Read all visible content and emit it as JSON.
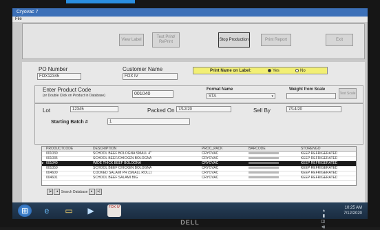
{
  "window": {
    "title": "Cryovac 7",
    "menu": "File"
  },
  "toolbar": {
    "view_label": "View Label",
    "test_print": "Test Print/ RePrint",
    "stop_production": "Stop Production",
    "print_report": "Print Report",
    "exit": "Exit"
  },
  "po": {
    "label": "PO Number",
    "value": "FOX12345"
  },
  "customer": {
    "label": "Customer Name",
    "value": "FOX IV"
  },
  "print_name": {
    "label": "Print Name on Label:",
    "yes": "Yes",
    "no": "No",
    "selected": "Yes"
  },
  "product": {
    "label": "Enter Product Code",
    "sublabel": "(or Double Click on Product in Database)",
    "value": "001040"
  },
  "format": {
    "label": "Format Name",
    "value": "STA"
  },
  "weight": {
    "label": "Weight from Scale",
    "test_scale": "Test Scale"
  },
  "lot": {
    "label": "Lot",
    "value": "12345"
  },
  "packed_on": {
    "label": "Packed On",
    "value": "7/12/20"
  },
  "sell_by": {
    "label": "Sell By",
    "value": "7/14/20"
  },
  "starting_batch": {
    "label": "Starting Batch #",
    "value": "1"
  },
  "grid": {
    "columns": [
      "PRODUCTCODE",
      "DESCRIPTION",
      "PROC_PACK",
      "BARCODE",
      "STORENGO"
    ],
    "rows": [
      {
        "code": "001030",
        "desc": "SCHOOL BEEF BOLOGNA SMALL 4\"",
        "pack": "CRYOVAC",
        "store": "KEEP REFRIGERATED",
        "selected": false
      },
      {
        "code": "001035",
        "desc": "SCHOOL BEEF/CHICKEN BOLOGNA",
        "pack": "CRYOVAC",
        "store": "KEEP REFRIGERATED",
        "selected": false
      },
      {
        "code": "001040",
        "desc": "WIDE THICK BEEF BOLOGNA",
        "pack": "CRYOVAC",
        "store": "KEEP REFRIGERATED",
        "selected": true
      },
      {
        "code": "001050",
        "desc": "SCHOOL BEEF CHICKEN BOLOGNA",
        "pack": "CRYOVAC",
        "store": "KEEP REFRIGERATED",
        "selected": false
      },
      {
        "code": "004600",
        "desc": "COOKED SALAMI PR (SMALL ROLL)",
        "pack": "CRYOVAC",
        "store": "KEEP REFRIGERATED",
        "selected": false
      },
      {
        "code": "004601",
        "desc": "SCHOOL BEEF SALAMI BIG",
        "pack": "CRYOVAC",
        "store": "KEEP REFRIGERATED",
        "selected": false
      }
    ],
    "nav_label": "Search Database"
  },
  "taskbar": {
    "app_label": "FOX IV",
    "time": "10:25 AM",
    "date": "7/12/2020"
  },
  "brand": "DELL",
  "colors": {
    "title_bar": "#3c70b8",
    "highlight": "#f2ef74",
    "taskbar": "#1a2c40"
  }
}
